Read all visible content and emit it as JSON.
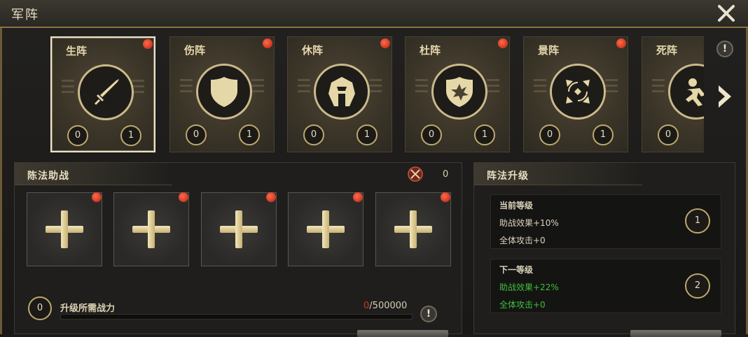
{
  "window": {
    "title": "军阵"
  },
  "formations": [
    {
      "name": "生阵",
      "left_level": "0",
      "right_level": "1",
      "icon": "sword-icon",
      "selected": true
    },
    {
      "name": "伤阵",
      "left_level": "0",
      "right_level": "1",
      "icon": "shield-icon",
      "selected": false
    },
    {
      "name": "休阵",
      "left_level": "0",
      "right_level": "1",
      "icon": "helmet-icon",
      "selected": false
    },
    {
      "name": "杜阵",
      "left_level": "0",
      "right_level": "1",
      "icon": "burst-shield-icon",
      "selected": false
    },
    {
      "name": "景阵",
      "left_level": "0",
      "right_level": "1",
      "icon": "target-arrows-icon",
      "selected": false
    },
    {
      "name": "死阵",
      "left_level": "0",
      "right_level": "",
      "icon": "running-figure-icon",
      "selected": false
    }
  ],
  "assist": {
    "title": "陈法助战",
    "count": "0",
    "slots": 5,
    "requirement_level": "0",
    "requirement_label": "升级所需战力",
    "current_power": "0",
    "power_separator": "/",
    "required_power": "500000",
    "progress": 0
  },
  "upgrade": {
    "title": "阵法升级",
    "current": {
      "heading": "当前等级",
      "level": "1",
      "assist_effect": "助战效果+10%",
      "all_attack": "全体攻击+0"
    },
    "next": {
      "heading": "下一等级",
      "level": "2",
      "assist_effect": "助战效果+22%",
      "all_attack": "全体攻击+0"
    }
  },
  "colors": {
    "gold": "#bfa86f",
    "red_dot": "#d8301a",
    "green_text": "#3fbf3a",
    "required_red": "#c93a26"
  }
}
